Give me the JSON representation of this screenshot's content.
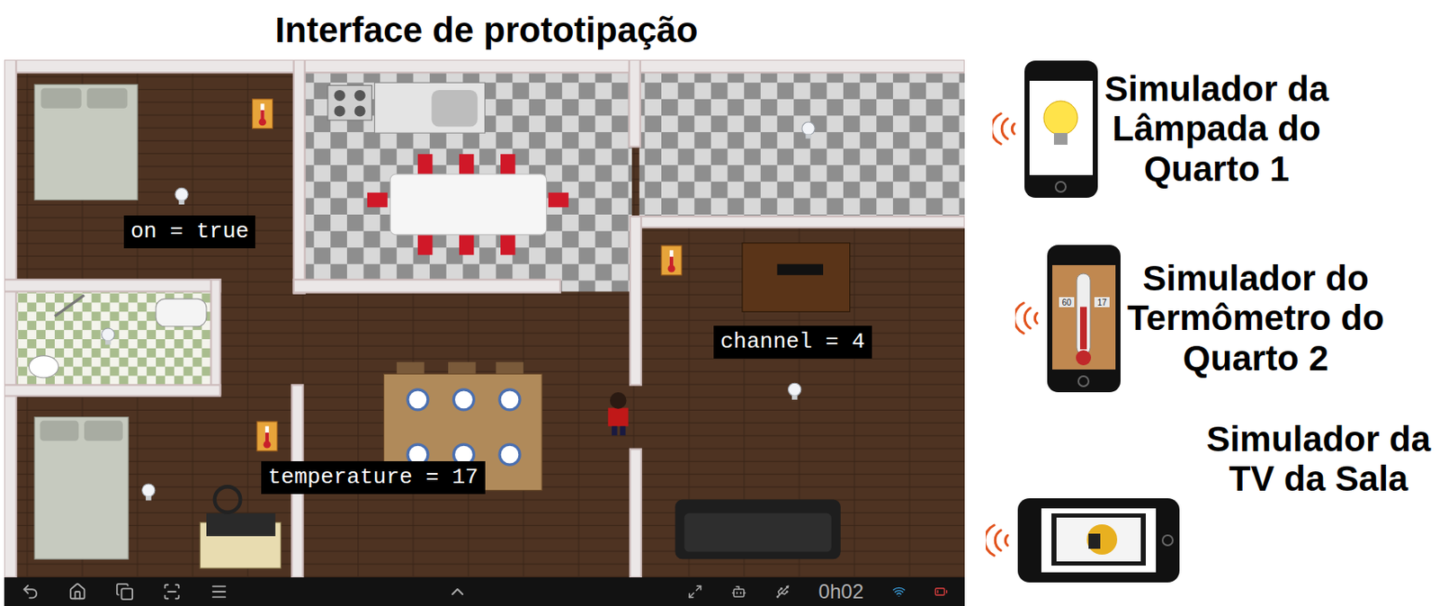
{
  "title": "Interface de prototipação",
  "floor_plan": {
    "readouts": [
      {
        "text": "on = true"
      },
      {
        "text": "channel = 4"
      },
      {
        "text": "temperature = 17"
      }
    ]
  },
  "nav_bar": {
    "clock": "0h02"
  },
  "simulators": [
    {
      "kind": "lamp",
      "lines": [
        "Simulador da",
        "Lâmpada do",
        "Quarto 1"
      ],
      "on": true
    },
    {
      "kind": "thermometer",
      "lines": [
        "Simulador do",
        "Termômetro do",
        "Quarto 2"
      ],
      "scale_left": "60",
      "scale_right": "17",
      "level": 0.6
    },
    {
      "kind": "tv",
      "lines": [
        "Simulador da",
        "TV da Sala"
      ]
    }
  ]
}
